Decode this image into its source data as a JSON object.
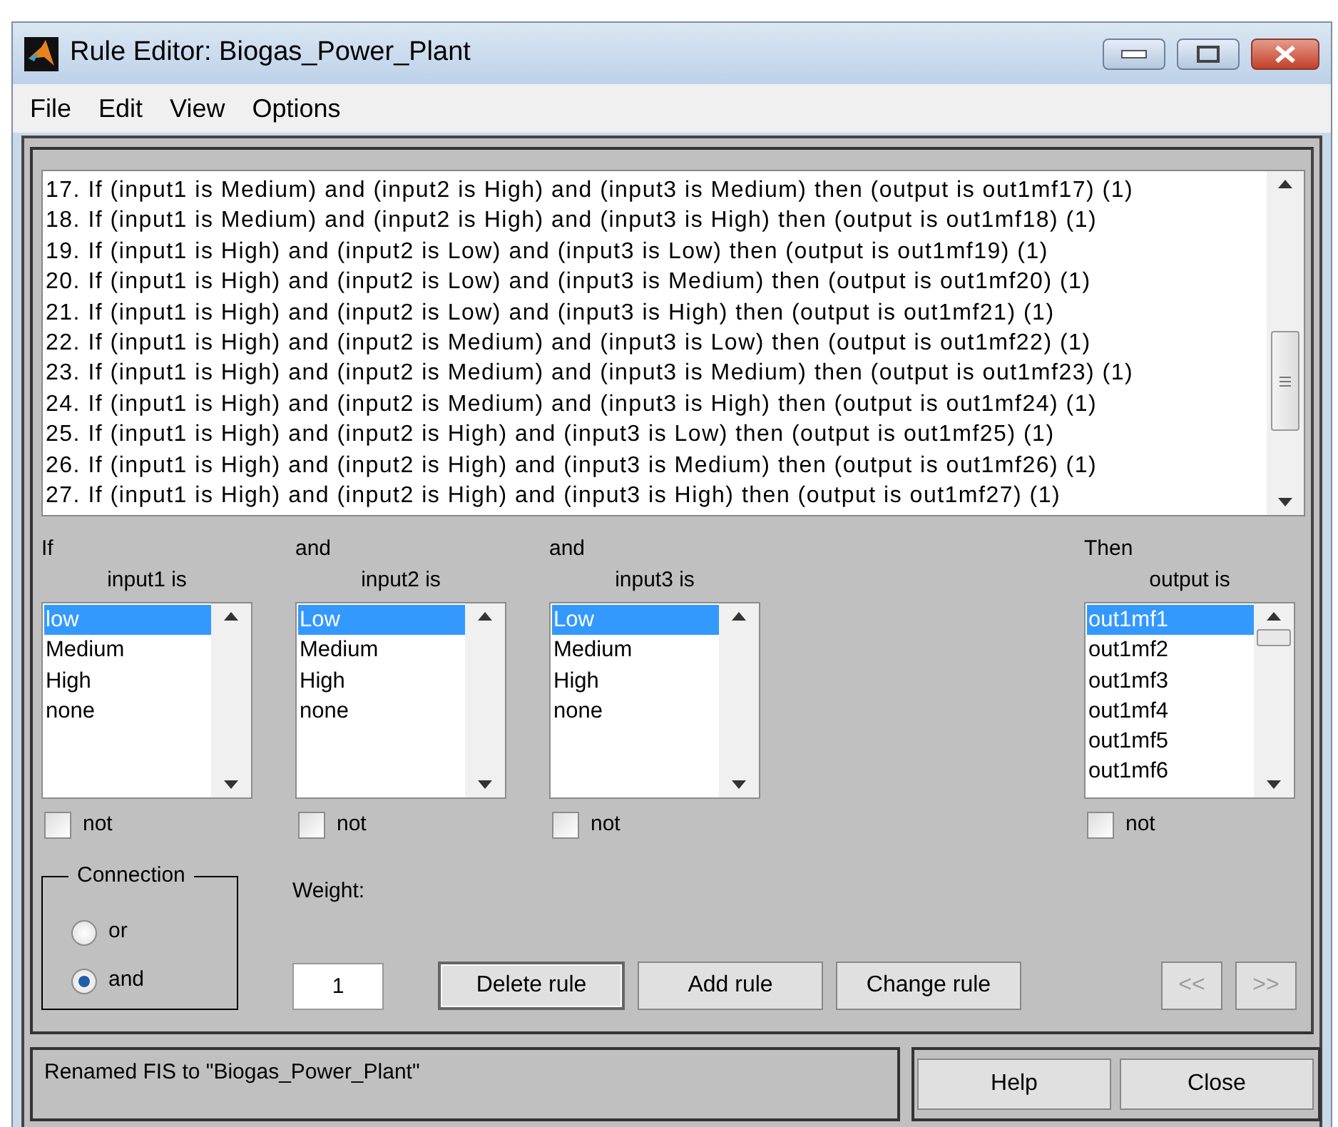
{
  "window": {
    "title": "Rule Editor: Biogas_Power_Plant"
  },
  "menu": [
    "File",
    "Edit",
    "View",
    "Options"
  ],
  "rules": [
    "17. If (input1 is Medium) and (input2 is High) and (input3 is Medium) then (output is out1mf17) (1)",
    "18. If (input1 is Medium) and (input2 is High) and (input3 is High) then (output is out1mf18) (1)",
    "19. If (input1 is High) and (input2 is Low) and (input3 is Low) then (output is out1mf19) (1)",
    "20. If (input1 is High) and (input2 is Low) and (input3 is Medium) then (output is out1mf20) (1)",
    "21. If (input1 is High) and (input2 is Low) and (input3 is High) then (output is out1mf21) (1)",
    "22. If (input1 is High) and (input2 is Medium) and (input3 is Low) then (output is out1mf22) (1)",
    "23. If (input1 is High) and (input2 is Medium) and (input3 is Medium) then (output is out1mf23) (1)",
    "24. If (input1 is High) and (input2 is Medium) and (input3 is High) then (output is out1mf24) (1)",
    "25. If (input1 is High) and (input2 is High) and (input3 is Low) then (output is out1mf25) (1)",
    "26. If (input1 is High) and (input2 is High) and (input3 is Medium) then (output is out1mf26) (1)",
    "27. If (input1 is High) and (input2 is High) and (input3 is High) then (output is out1mf27) (1)"
  ],
  "antecedents": [
    {
      "connector": "If",
      "label": "input1 is",
      "not_label": "not",
      "negated": false,
      "options": [
        {
          "label": "low",
          "selected": true
        },
        {
          "label": "Medium",
          "selected": false
        },
        {
          "label": "High",
          "selected": false
        },
        {
          "label": "none",
          "selected": false
        }
      ]
    },
    {
      "connector": "and",
      "label": "input2 is",
      "not_label": "not",
      "negated": false,
      "options": [
        {
          "label": "Low",
          "selected": true
        },
        {
          "label": "Medium",
          "selected": false
        },
        {
          "label": "High",
          "selected": false
        },
        {
          "label": "none",
          "selected": false
        }
      ]
    },
    {
      "connector": "and",
      "label": "input3 is",
      "not_label": "not",
      "negated": false,
      "options": [
        {
          "label": "Low",
          "selected": true
        },
        {
          "label": "Medium",
          "selected": false
        },
        {
          "label": "High",
          "selected": false
        },
        {
          "label": "none",
          "selected": false
        }
      ]
    }
  ],
  "consequent": {
    "connector": "Then",
    "label": "output is",
    "not_label": "not",
    "negated": false,
    "options": [
      {
        "label": "out1mf1",
        "selected": true
      },
      {
        "label": "out1mf2",
        "selected": false
      },
      {
        "label": "out1mf3",
        "selected": false
      },
      {
        "label": "out1mf4",
        "selected": false
      },
      {
        "label": "out1mf5",
        "selected": false
      },
      {
        "label": "out1mf6",
        "selected": false
      }
    ]
  },
  "connection": {
    "title": "Connection",
    "options": [
      {
        "label": "or",
        "selected": false
      },
      {
        "label": "and",
        "selected": true
      }
    ]
  },
  "weight": {
    "label": "Weight:",
    "value": "1"
  },
  "rule_buttons": [
    {
      "label": "Delete rule",
      "disabled": false
    },
    {
      "label": "Add rule",
      "disabled": false
    },
    {
      "label": "Change rule",
      "disabled": false
    }
  ],
  "nav_buttons": [
    {
      "label": "<<",
      "disabled": true
    },
    {
      "label": ">>",
      "disabled": true
    }
  ],
  "status": "Renamed FIS to \"Biogas_Power_Plant\"",
  "dialog_buttons": [
    "Help",
    "Close"
  ]
}
